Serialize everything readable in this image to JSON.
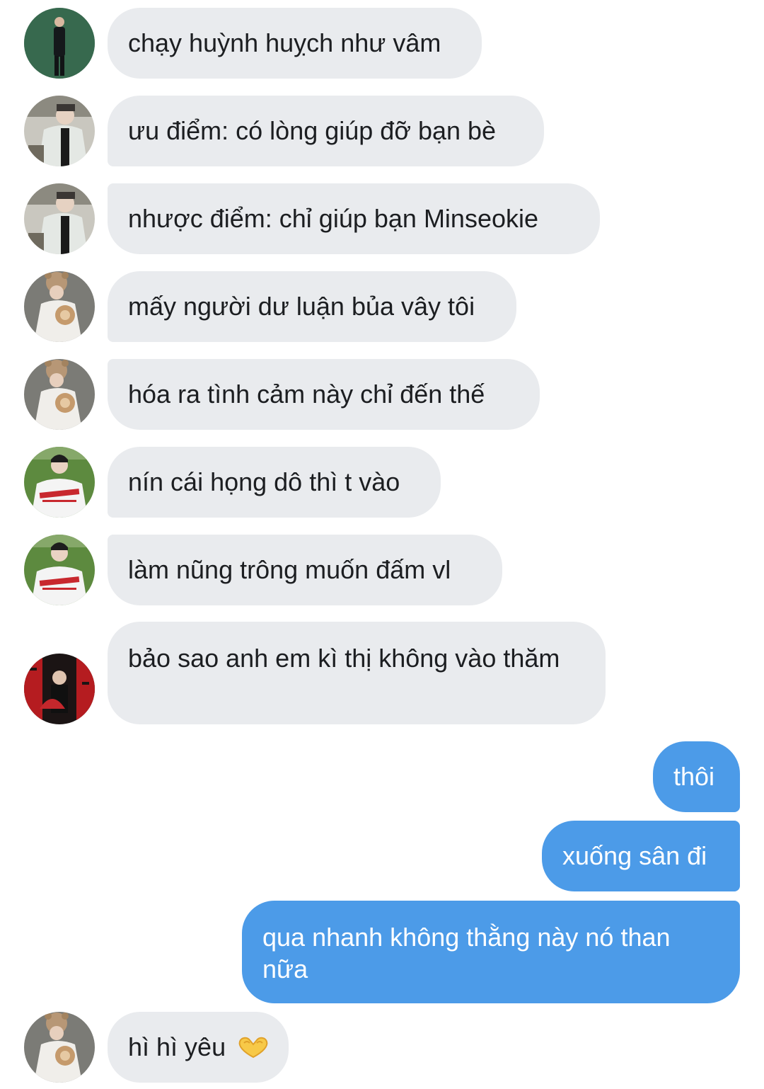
{
  "messages": [
    {
      "sender": "other",
      "text": "chạy huỳnh huỵch như vâm"
    },
    {
      "sender": "other",
      "text": "ưu điểm: có lòng giúp đỡ bạn bè"
    },
    {
      "sender": "other",
      "text": "nhược điểm: chỉ giúp bạn Minseokie"
    },
    {
      "sender": "other",
      "text": "mấy người dư luận bủa vây tôi"
    },
    {
      "sender": "other",
      "text": "hóa ra tình cảm này chỉ đến thế"
    },
    {
      "sender": "other",
      "text": "nín cái họng dô thì t vào"
    },
    {
      "sender": "other",
      "text": "làm nũng trông muốn đấm vl"
    },
    {
      "sender": "other",
      "text": "bảo sao anh em kì thị không vào thăm"
    },
    {
      "sender": "self",
      "text": "thôi"
    },
    {
      "sender": "self",
      "text": "xuống sân đi"
    },
    {
      "sender": "self",
      "text": "qua nhanh không thằng này nó than nữa"
    },
    {
      "sender": "other",
      "text": "hì hì yêu",
      "emoji": "heart-hands-icon"
    }
  ],
  "colors": {
    "incoming_bubble": "#e9ebee",
    "outgoing_bubble": "#4c9be8",
    "outgoing_text": "#ffffff",
    "incoming_text": "#1c1e21"
  }
}
